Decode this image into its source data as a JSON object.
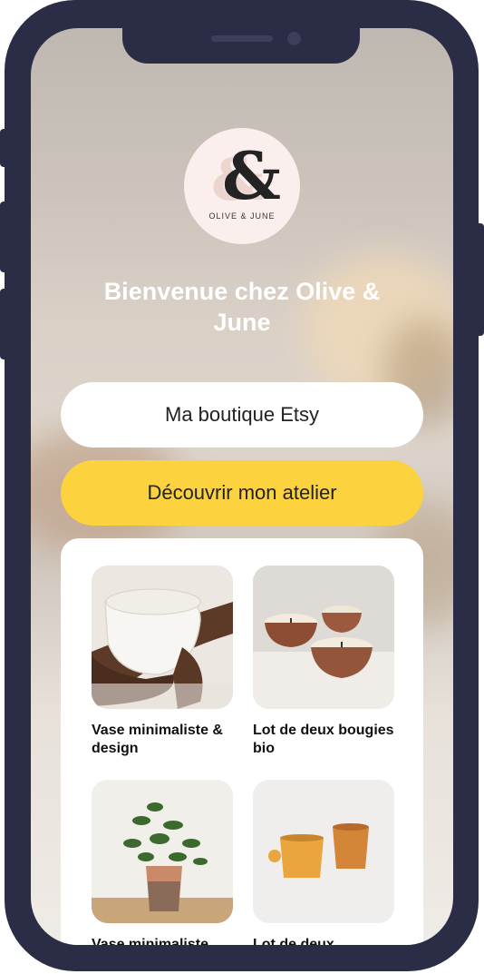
{
  "app": {
    "brand_name": "OLIVE & JUNE",
    "logo_glyph": "&",
    "welcome_title": "Bienvenue chez Olive & June"
  },
  "buttons": {
    "etsy_label": "Ma boutique Etsy",
    "atelier_label": "Découvrir mon atelier"
  },
  "products": [
    {
      "name": "Vase minimaliste & design",
      "image": "white-bowl-held-in-hands"
    },
    {
      "name": "Lot de deux bougies bio",
      "image": "three-terracotta-candles"
    },
    {
      "name": "Vase minimaliste",
      "image": "plant-in-clay-pot"
    },
    {
      "name": "Lot de deux",
      "image": "two-ochre-cups"
    }
  ],
  "colors": {
    "phone_frame": "#2b2c45",
    "accent_yellow": "#fcd23e",
    "card_bg": "#ffffff"
  }
}
